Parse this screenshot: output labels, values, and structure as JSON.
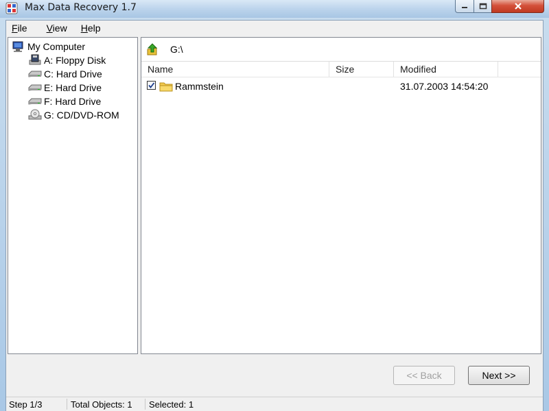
{
  "window": {
    "title": "Max Data Recovery 1.7"
  },
  "menu": [
    {
      "label": "File",
      "accel": "F",
      "rest": "ile"
    },
    {
      "label": "View",
      "accel": "V",
      "rest": "iew"
    },
    {
      "label": "Help",
      "accel": "H",
      "rest": "elp"
    }
  ],
  "tree": {
    "root": {
      "label": "My Computer",
      "icon": "computer-icon"
    },
    "drives": [
      {
        "label": "A: Floppy Disk",
        "icon": "floppy-drive-icon"
      },
      {
        "label": "C: Hard Drive",
        "icon": "hard-drive-icon"
      },
      {
        "label": "E: Hard Drive",
        "icon": "hard-drive-icon"
      },
      {
        "label": "F: Hard Drive",
        "icon": "hard-drive-icon"
      },
      {
        "label": "G: CD/DVD-ROM",
        "icon": "cd-drive-icon"
      }
    ]
  },
  "path": {
    "current": "G:\\"
  },
  "list": {
    "columns": [
      "Name",
      "Size",
      "Modified"
    ],
    "rows": [
      {
        "name": "Rammstein",
        "size": "",
        "modified": "31.07.2003 14:54:20",
        "checked": true,
        "icon": "folder-icon"
      }
    ]
  },
  "buttons": {
    "back": "<< Back",
    "next": "Next >>"
  },
  "status": {
    "step": "Step 1/3",
    "total": "Total Objects: 1",
    "selected": "Selected: 1"
  }
}
